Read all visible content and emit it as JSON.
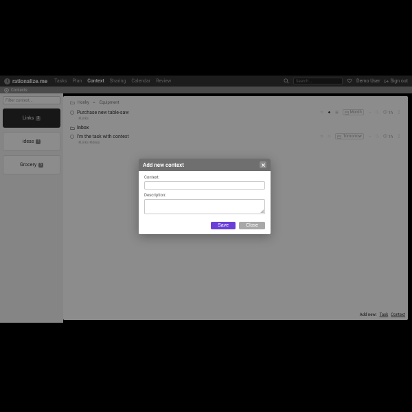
{
  "brand": "rationalize.me",
  "nav": {
    "tasks": "Tasks",
    "plan": "Plan",
    "context": "Context",
    "sharing": "Sharing",
    "calendar": "Calendar",
    "review": "Review"
  },
  "search": {
    "placeholder": "Search..."
  },
  "user": {
    "name": "Demo User",
    "signout": "Sign out"
  },
  "subheader": {
    "title": "Contexts"
  },
  "sidebar": {
    "filter_placeholder": "Filter context...",
    "contexts": [
      {
        "name": "Links",
        "count": "3"
      },
      {
        "name": "ideas",
        "count": "1"
      },
      {
        "name": "Grocery",
        "count": "5"
      }
    ]
  },
  "main": {
    "breadcrumb": {
      "a": "Honky",
      "b": "Equipment"
    },
    "task1": {
      "title": "Purchase new table-saw",
      "sub": "#Links",
      "date": "Month",
      "duration": "1h"
    },
    "section": "Inbox",
    "task2": {
      "title": "I'm the task with context",
      "sub": "#Links  #ideas",
      "date": "Tomorrow",
      "duration": "1h"
    }
  },
  "footer": {
    "label": "Add new:",
    "task": "Task",
    "context": "Context"
  },
  "modal": {
    "title": "Add new context",
    "context_label": "Context:",
    "description_label": "Description:",
    "save": "Save",
    "close": "Close"
  }
}
